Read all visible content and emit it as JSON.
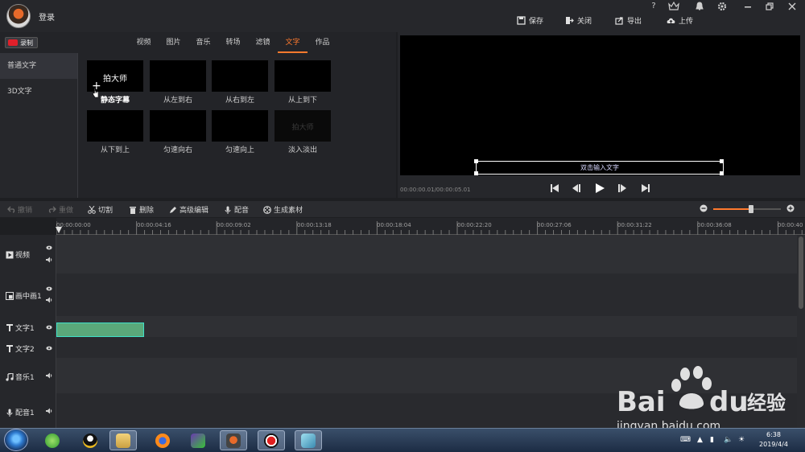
{
  "header": {
    "login_label": "登录",
    "buttons": [
      {
        "label": "保存",
        "icon": "save-icon"
      },
      {
        "label": "关闭",
        "icon": "close-project-icon"
      },
      {
        "label": "导出",
        "icon": "export-icon"
      },
      {
        "label": "上传",
        "icon": "upload-icon"
      }
    ],
    "window_controls": [
      "?",
      "vip",
      "bell",
      "gear",
      "minimize",
      "restore",
      "close"
    ]
  },
  "record_label": "录制",
  "tabs": [
    "视频",
    "图片",
    "音乐",
    "转场",
    "滤镜",
    "文字",
    "作品"
  ],
  "active_tab": "文字",
  "categories": [
    "普通文字",
    "3D文字"
  ],
  "active_category": "普通文字",
  "templates": [
    {
      "label": "静态字幕",
      "preview_text": "拍大师"
    },
    {
      "label": "从左到右",
      "preview_text": ""
    },
    {
      "label": "从右到左",
      "preview_text": ""
    },
    {
      "label": "从上到下",
      "preview_text": ""
    },
    {
      "label": "从下到上",
      "preview_text": ""
    },
    {
      "label": "匀速向右",
      "preview_text": ""
    },
    {
      "label": "匀速向上",
      "preview_text": ""
    },
    {
      "label": "淡入淡出",
      "preview_text": "拍大师"
    }
  ],
  "preview": {
    "text_placeholder": "双击输入文字",
    "timecode": "00:00:00.01/00:00:05.01"
  },
  "toolbar": {
    "undo": "撤销",
    "redo": "重做",
    "cut": "切割",
    "delete": "删除",
    "advanced_edit": "高级编辑",
    "dub": "配音",
    "generate": "生成素材",
    "zoom_level": 0.56
  },
  "ruler_ticks": [
    "00:00:00:00",
    "00:00:04:16",
    "00:00:09:02",
    "00:00:13:18",
    "00:00:18:04",
    "00:00:22:20",
    "00:00:27:06",
    "00:00:31:22",
    "00:00:36:08",
    "00:00:40"
  ],
  "tracks": [
    "视频",
    "画中画1",
    "文字1",
    "文字2",
    "音乐1",
    "配音1"
  ],
  "taskbar": {
    "time": "6:38",
    "date": "2019/4/4"
  },
  "watermark": {
    "brand": "Bai du 经验",
    "url": "jingyan.baidu.com"
  }
}
